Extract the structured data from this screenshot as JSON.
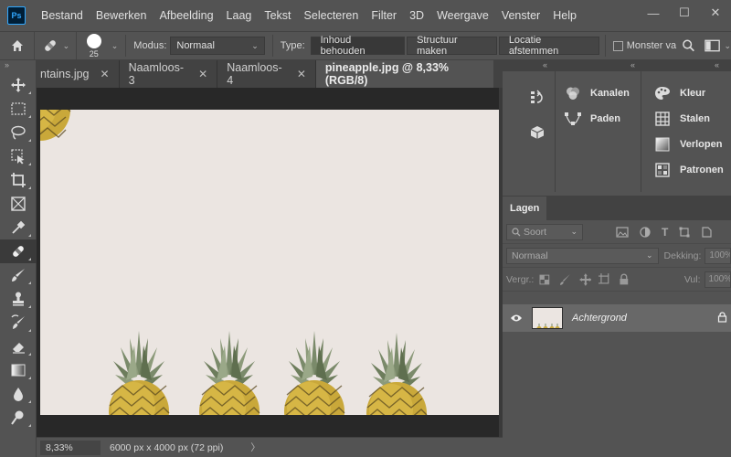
{
  "app": {
    "logo_text": "Ps"
  },
  "menu": [
    "Bestand",
    "Bewerken",
    "Afbeelding",
    "Laag",
    "Tekst",
    "Selecteren",
    "Filter",
    "3D",
    "Weergave",
    "Venster",
    "Help"
  ],
  "window_controls": {
    "minimize": "—",
    "maximize": "☐",
    "close": "✕"
  },
  "options": {
    "brush_size": "25",
    "mode_label": "Modus:",
    "mode_value": "Normaal",
    "type_label": "Type:",
    "type_buttons": [
      "Inhoud behouden",
      "Structuur maken",
      "Locatie afstemmen"
    ],
    "sample_label": "Monster va"
  },
  "tabs": [
    {
      "label": "ntains.jpg"
    },
    {
      "label": "Naamloos-3"
    },
    {
      "label": "Naamloos-4"
    },
    {
      "label": "pineapple.jpg @ 8,33% (RGB/8)",
      "active": true
    }
  ],
  "tab_close": "✕",
  "status": {
    "zoom": "8,33%",
    "doc_info": "6000 px x 4000 px (72 ppi)",
    "arrow": "〉"
  },
  "panels": {
    "group_a": [
      "Kanalen",
      "Paden"
    ],
    "group_b": [
      "Kleur",
      "Stalen",
      "Verlopen",
      "Patronen"
    ]
  },
  "layers_panel": {
    "tab": "Lagen",
    "kind_filter": "Soort",
    "blend_mode": "Normaal",
    "opacity_label": "Dekking:",
    "opacity_value": "100%",
    "lock_label": "Vergr.:",
    "fill_label": "Vul:",
    "fill_value": "100%",
    "layer_name": "Achtergrond"
  },
  "colors": {
    "canvas_bg": "#ebe5e1",
    "ui_bg": "#535353",
    "dark_bg": "#282828",
    "accent": "#31a8ff"
  }
}
